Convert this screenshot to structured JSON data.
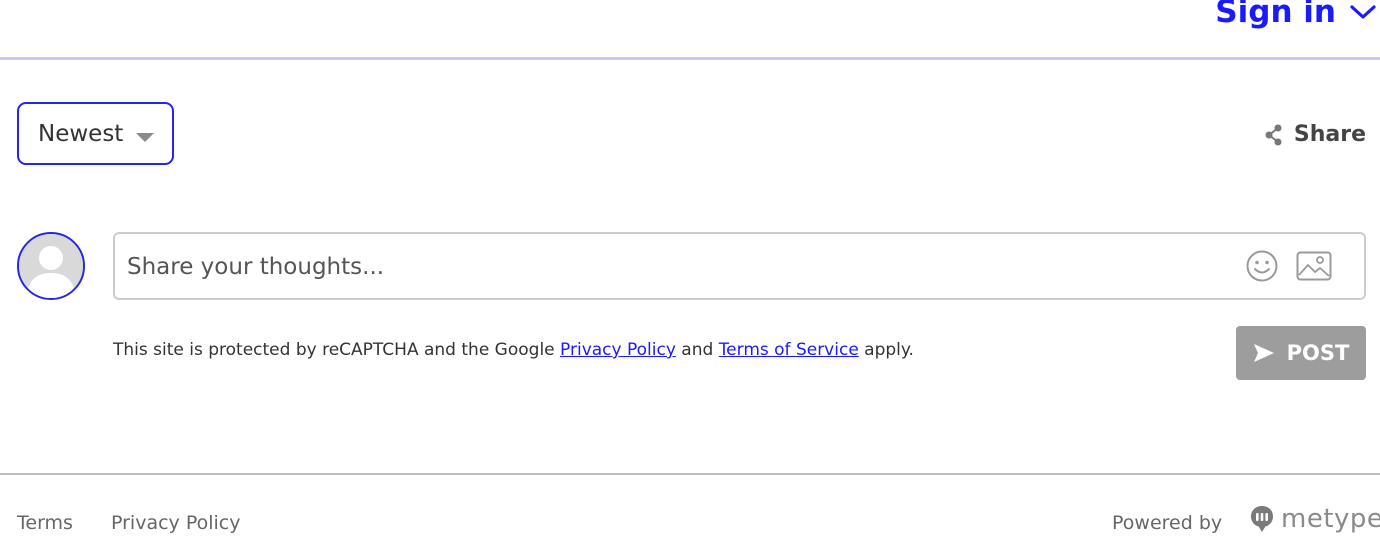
{
  "header": {
    "signin_label": "Sign in"
  },
  "toolbar": {
    "sort_value": "Newest",
    "share_label": "Share"
  },
  "composer": {
    "placeholder": "Share your thoughts...",
    "post_label": "POST"
  },
  "notice": {
    "prefix": "This site is protected by reCAPTCHA and the Google ",
    "privacy_link": "Privacy Policy",
    "middle": " and ",
    "terms_link": "Terms of Service",
    "suffix": " apply."
  },
  "footer": {
    "terms": "Terms",
    "privacy": "Privacy Policy",
    "powered_by": "Powered by",
    "brand": "metype"
  },
  "colors": {
    "accent": "#1a1aff",
    "border_accent": "#2626e6",
    "header_rule": "#c9c8f5",
    "post_button_disabled": "#9d9d9d"
  },
  "icons": [
    "chevron-down-icon",
    "caret-down-icon",
    "share-icon",
    "avatar-placeholder-icon",
    "emoji-icon",
    "image-icon",
    "send-icon",
    "metype-logo-icon"
  ]
}
